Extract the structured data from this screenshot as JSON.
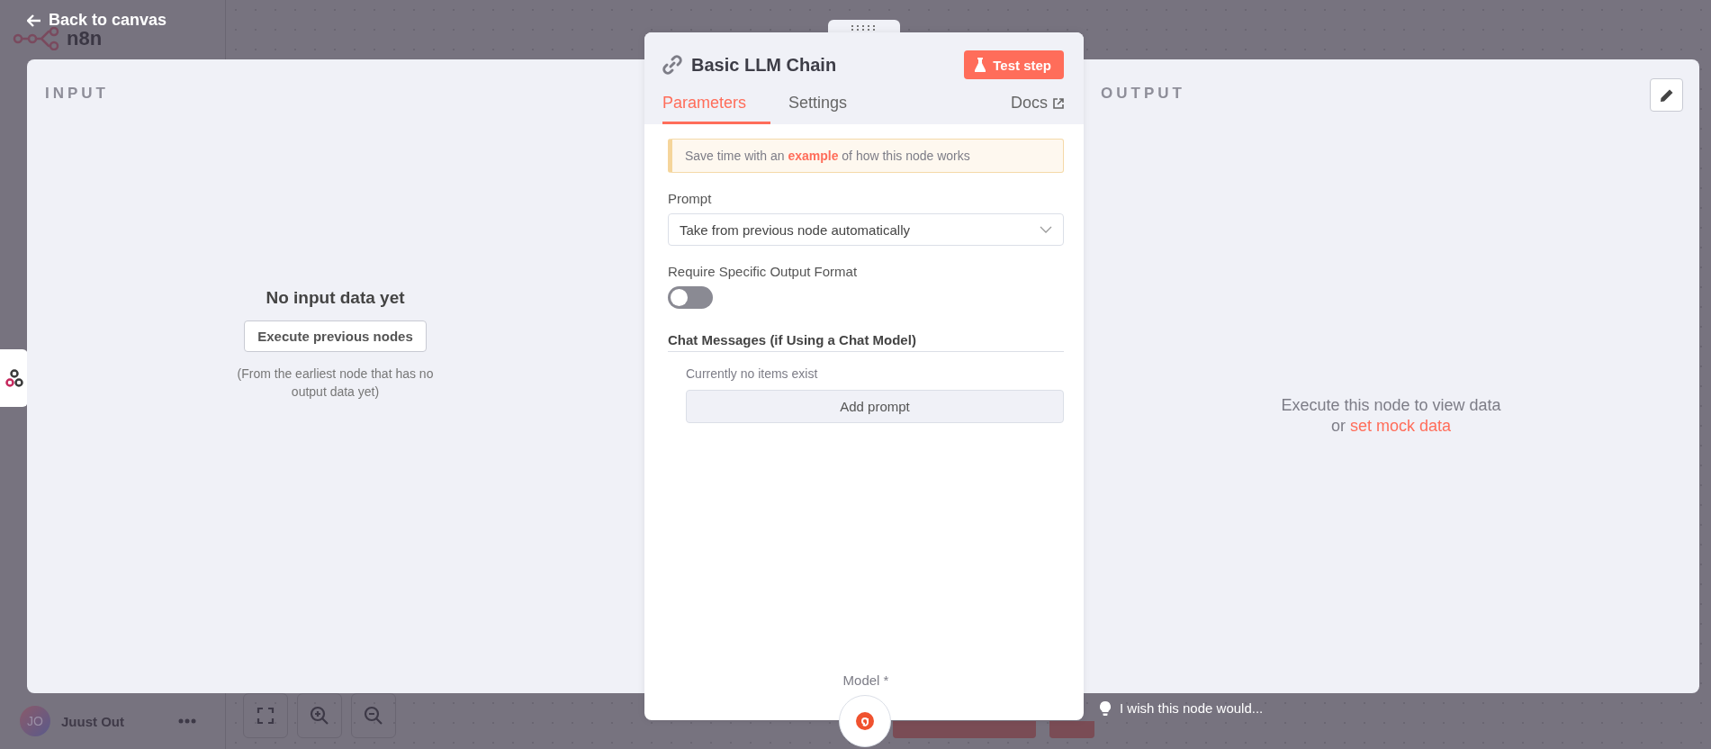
{
  "app": {
    "logo": "n8n",
    "user": {
      "initials": "JO",
      "name": "Juust Out"
    }
  },
  "back_link": "Back to canvas",
  "input_panel": {
    "title": "INPUT",
    "message": "No input data yet",
    "button": "Execute previous nodes",
    "hint": "(From the earliest node that has no output data yet)"
  },
  "node": {
    "title": "Basic LLM Chain",
    "test_button": "Test step",
    "tabs": [
      {
        "label": "Parameters",
        "selected": true
      },
      {
        "label": "Settings",
        "selected": false
      }
    ],
    "docs_link": "Docs",
    "callout": {
      "before": "Save time with an ",
      "link": "example",
      "after": " of how this node works"
    },
    "parameters": [
      {
        "kind": "select",
        "label": "Prompt",
        "value": "Take from previous node automatically"
      },
      {
        "kind": "toggle",
        "label": "Require Specific Output Format",
        "on": false
      },
      {
        "kind": "collection",
        "label": "Chat Messages (if Using a Chat Model)",
        "empty_text": "Currently no items exist",
        "button": "Add prompt"
      }
    ],
    "model_label": "Model *"
  },
  "output_panel": {
    "title": "OUTPUT",
    "message": "Execute this node to view data",
    "prefix": "or ",
    "link": "set mock data"
  },
  "feedback": "I wish this node would..."
}
